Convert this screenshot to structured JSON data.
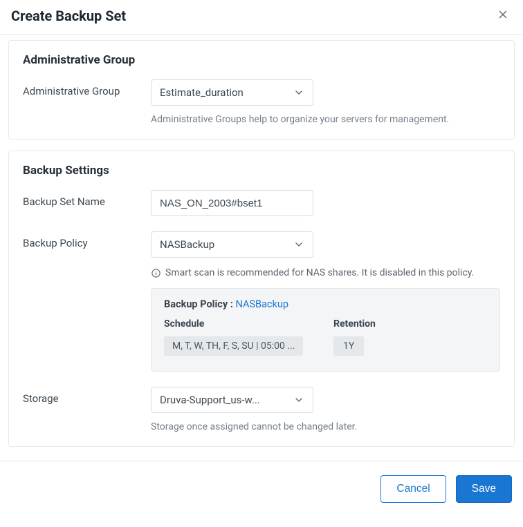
{
  "header": {
    "title": "Create Backup Set"
  },
  "section_admin": {
    "title": "Administrative Group",
    "label": "Administrative Group",
    "value": "Estimate_duration",
    "helper": "Administrative Groups help to organize your servers for management."
  },
  "section_backup": {
    "title": "Backup Settings",
    "name_label": "Backup Set Name",
    "name_value": "NAS_ON_2003#bset1",
    "policy_label": "Backup Policy",
    "policy_value": "NASBackup",
    "policy_info": "Smart scan is recommended for NAS shares. It is disabled in this policy.",
    "policy_card": {
      "prefix": "Backup Policy : ",
      "link": "NASBackup",
      "schedule_head": "Schedule",
      "retention_head": "Retention",
      "schedule_value": "M, T, W, TH, F, S, SU | 05:00 ...",
      "retention_value": "1Y"
    },
    "storage_label": "Storage",
    "storage_value": "Druva-Support_us-w...",
    "storage_helper": "Storage once assigned cannot be changed later."
  },
  "footer": {
    "cancel": "Cancel",
    "save": "Save"
  }
}
